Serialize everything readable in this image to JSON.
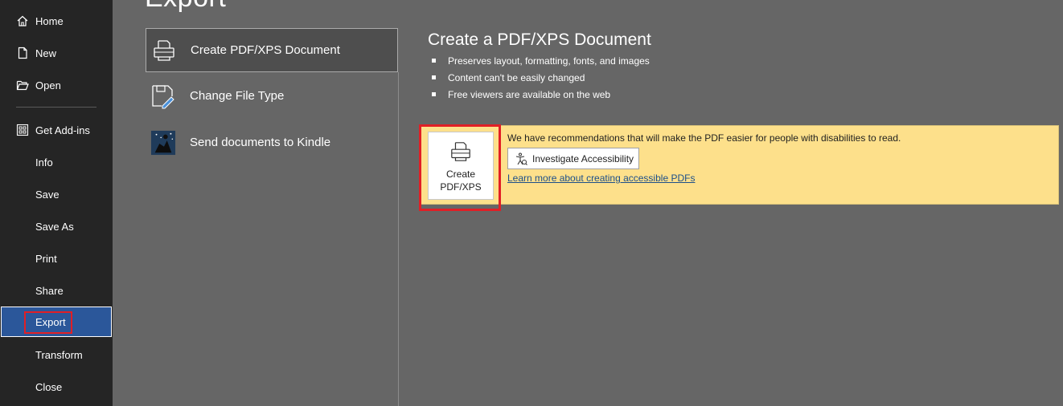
{
  "page": {
    "title": "Export"
  },
  "nav": {
    "items": [
      {
        "label": "Home",
        "icon": "home-icon"
      },
      {
        "label": "New",
        "icon": "new-document-icon"
      },
      {
        "label": "Open",
        "icon": "open-folder-icon"
      },
      {
        "label": "Get Add-ins",
        "icon": "add-ins-icon"
      },
      {
        "label": "Info"
      },
      {
        "label": "Save"
      },
      {
        "label": "Save As"
      },
      {
        "label": "Print"
      },
      {
        "label": "Share"
      },
      {
        "label": "Export",
        "selected": true
      },
      {
        "label": "Transform"
      },
      {
        "label": "Close"
      }
    ]
  },
  "options": [
    {
      "label": "Create PDF/XPS Document",
      "icon": "pdf-document-icon",
      "selected": true
    },
    {
      "label": "Change File Type",
      "icon": "change-file-type-icon"
    },
    {
      "label": "Send documents to Kindle",
      "icon": "kindle-icon"
    }
  ],
  "detail": {
    "title": "Create a PDF/XPS Document",
    "bullets": [
      "Preserves layout, formatting, fonts, and images",
      "Content can't be easily changed",
      "Free viewers are available on the web"
    ],
    "create_button": {
      "line1": "Create",
      "line2": "PDF/XPS",
      "icon": "pdf-document-icon"
    },
    "notice_text": "We have recommendations that will make the PDF easier for people with disabilities to read.",
    "investigate_label": "Investigate Accessibility",
    "learn_more_link": "Learn more about creating accessible PDFs"
  },
  "colors": {
    "nav_bg": "#252525",
    "content_bg": "#666666",
    "selected_nav": "#2b579a",
    "highlight_red": "#e11f26",
    "notice_bg": "#fde08b",
    "link": "#1c4f8a"
  }
}
